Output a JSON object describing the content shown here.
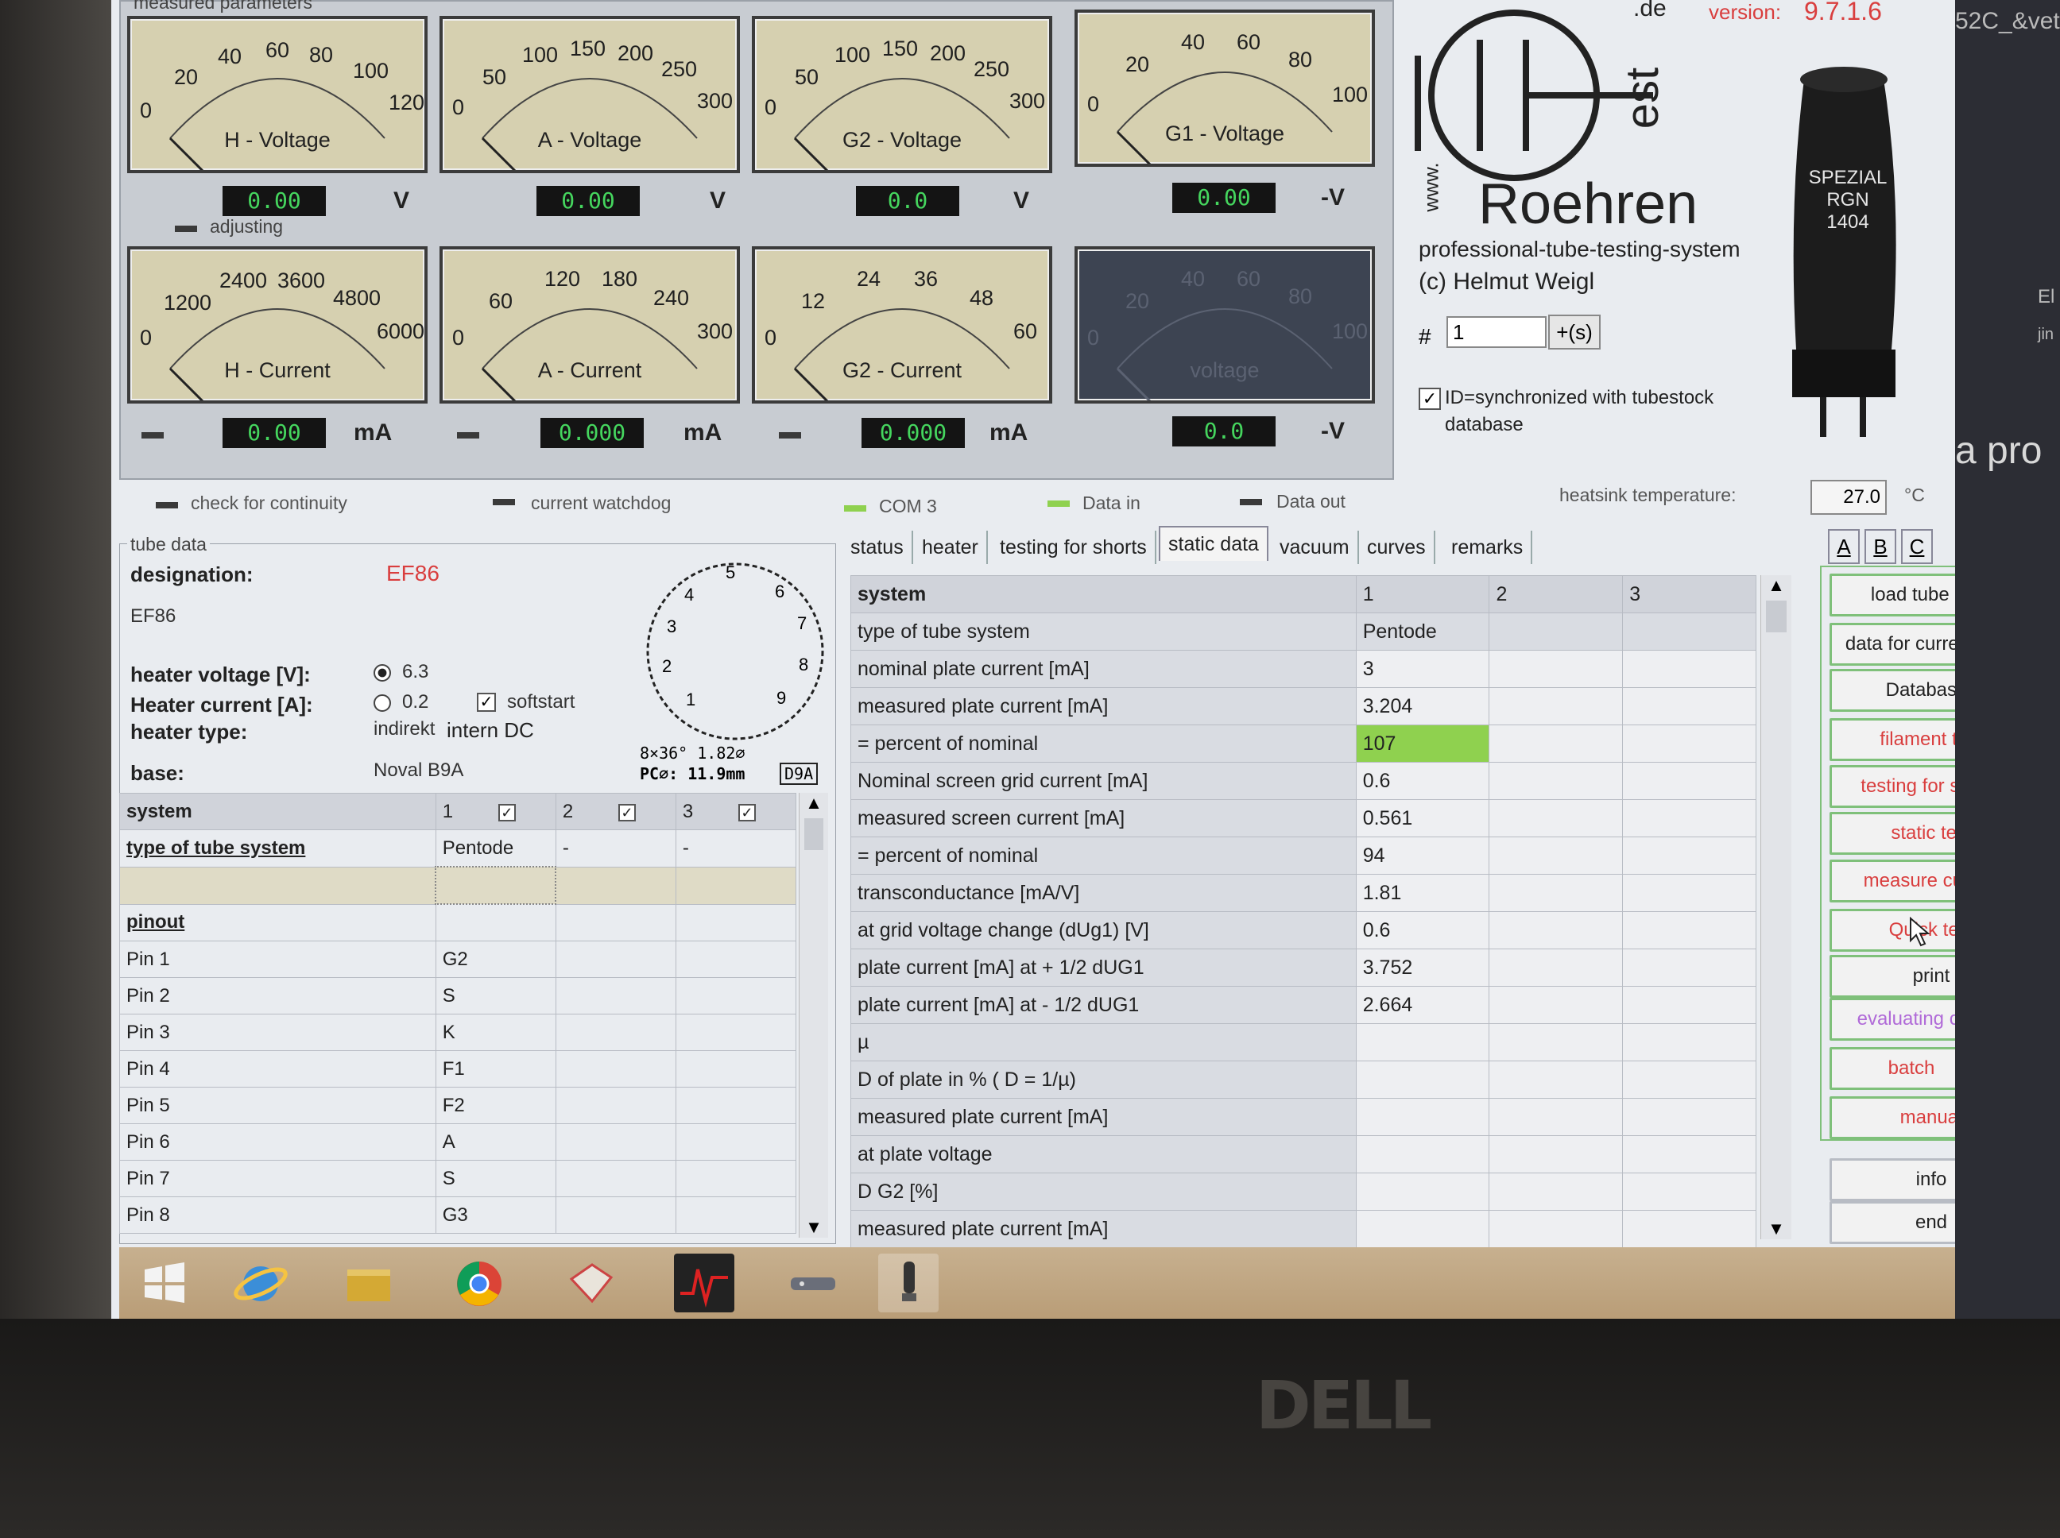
{
  "meters_title": "measured parameters",
  "meters": [
    {
      "name": "H - Voltage",
      "scale": [
        "0",
        "20",
        "40",
        "60",
        "80",
        "100",
        "120"
      ],
      "display": "0.00",
      "unit": "V"
    },
    {
      "name": "A - Voltage",
      "scale": [
        "0",
        "50",
        "100",
        "150",
        "200",
        "250",
        "300"
      ],
      "display": "0.00",
      "unit": "V"
    },
    {
      "name": "G2 - Voltage",
      "scale": [
        "0",
        "50",
        "100",
        "150",
        "200",
        "250",
        "300"
      ],
      "display": "0.0",
      "unit": "V"
    },
    {
      "name": "G1 - Voltage",
      "scale": [
        "0",
        "20",
        "40",
        "60",
        "80",
        "100"
      ],
      "display": "0.00",
      "unit": "-V"
    },
    {
      "name": "H - Current",
      "scale": [
        "0",
        "1200",
        "2400",
        "3600",
        "4800",
        "6000"
      ],
      "display": "0.00",
      "unit": "mA"
    },
    {
      "name": "A - Current",
      "scale": [
        "0",
        "60",
        "120",
        "180",
        "240",
        "300"
      ],
      "display": "0.000",
      "unit": "mA"
    },
    {
      "name": "G2 - Current",
      "scale": [
        "0",
        "12",
        "24",
        "36",
        "48",
        "60"
      ],
      "display": "0.000",
      "unit": "mA"
    },
    {
      "name": "voltage",
      "scale": [
        "0",
        "20",
        "40",
        "60",
        "80",
        "100"
      ],
      "display": "0.0",
      "unit": "-V"
    }
  ],
  "adjusting_label": "adjusting",
  "brand": {
    "version_label": "version:",
    "version": "9.7.1.6",
    "domain": ".de",
    "www": "www.",
    "logo_text": "Roehren",
    "logo_suffix": "est",
    "tagline": "professional-tube-testing-system",
    "copyright": "(c) Helmut Weigl",
    "tube_print": "SPEZIAL RGN 1404"
  },
  "counter": {
    "hash": "#",
    "value": "1",
    "plus_button": "+(s)"
  },
  "sync_label": "ID=synchronized with tubestock database",
  "status_bar": {
    "continuity": "check for continuity",
    "watchdog": "current watchdog",
    "com": "COM 3",
    "data_in": "Data in",
    "data_out": "Data out",
    "heatsink_label": "heatsink temperature:",
    "heatsink_value": "27.0",
    "heatsink_unit": "°C"
  },
  "tube_data": {
    "legend": "tube data",
    "designation_label": "designation:",
    "designation": "EF86",
    "designation_sub": "EF86",
    "heater_voltage_label": "heater voltage [V]:",
    "heater_voltage": "6.3",
    "heater_current_label": "Heater current [A]:",
    "heater_current": "0.2",
    "softstart": "softstart",
    "heater_type_label": "heater type:",
    "heater_type": "indirekt",
    "heater_supply": "intern DC",
    "base_label": "base:",
    "base": "Noval B9A",
    "socket_dims": "8×36° 1.82⌀",
    "socket_pc": "PC⌀: 11.9mm",
    "socket_code": "D9A",
    "pin_numbers": [
      "1",
      "2",
      "3",
      "4",
      "5",
      "6",
      "7",
      "8",
      "9"
    ]
  },
  "left_table": {
    "header": [
      "system",
      "1",
      "2",
      "3"
    ],
    "type_label": "type of tube system",
    "type_values": [
      "Pentode",
      "-",
      "-"
    ],
    "pinout_label": "pinout",
    "pins": [
      {
        "pin": "Pin 1",
        "value": "G2"
      },
      {
        "pin": "Pin 2",
        "value": "S"
      },
      {
        "pin": "Pin 3",
        "value": "K"
      },
      {
        "pin": "Pin 4",
        "value": "F1"
      },
      {
        "pin": "Pin 5",
        "value": "F2"
      },
      {
        "pin": "Pin 6",
        "value": "A"
      },
      {
        "pin": "Pin 7",
        "value": "S"
      },
      {
        "pin": "Pin 8",
        "value": "G3"
      }
    ]
  },
  "tabs": [
    "status",
    "heater",
    "testing for shorts",
    "static data",
    "vacuum",
    "curves",
    "remarks"
  ],
  "abc_tabs": [
    "A",
    "B",
    "C"
  ],
  "static_table": {
    "header": [
      "system",
      "1",
      "2",
      "3"
    ],
    "rows": [
      {
        "label": "type of tube system",
        "v1": "Pentode"
      },
      {
        "label": "nominal plate current [mA]",
        "v1": "3"
      },
      {
        "label": "measured plate current [mA]",
        "v1": "3.204"
      },
      {
        "label": "= percent of nominal",
        "v1": "107"
      },
      {
        "label": "Nominal screen grid current [mA]",
        "v1": "0.6"
      },
      {
        "label": "measured screen current [mA]",
        "v1": "0.561"
      },
      {
        "label": "= percent of nominal",
        "v1": "94"
      },
      {
        "label": "transconductance [mA/V]",
        "v1": "1.81"
      },
      {
        "label": "at grid voltage change (dUg1) [V]",
        "v1": "0.6"
      },
      {
        "label": "plate current [mA] at + 1/2 dUG1",
        "v1": "3.752"
      },
      {
        "label": "plate current [mA] at - 1/2 dUG1",
        "v1": "2.664"
      },
      {
        "label": "µ",
        "v1": ""
      },
      {
        "label": "D of plate in % ( D = 1/µ)",
        "v1": ""
      },
      {
        "label": "measured plate current [mA]",
        "v1": ""
      },
      {
        "label": "at plate voltage",
        "v1": ""
      },
      {
        "label": "D G2 [%]",
        "v1": ""
      },
      {
        "label": "measured plate current [mA]",
        "v1": ""
      }
    ]
  },
  "buttons": {
    "load": "load tube data",
    "current": "data for current tube",
    "databases": "Databases",
    "filament": "filament test",
    "shorts": "testing for shorts",
    "static": "static test",
    "curves": "measure curves",
    "quick": "Quick test",
    "print": "print",
    "evaluating": "evaluating curves",
    "batch": "batch",
    "manual": "manual",
    "info": "info",
    "end": "end"
  },
  "background_window": {
    "title_fragment": "52C_&vet",
    "text_fragment": "a pro",
    "side_text": "El",
    "side_text2": "jin"
  },
  "colors": {
    "accent_green": "#8fd14f",
    "red_text": "#d93e3e",
    "purple_text": "#b06ad8",
    "lcd_green": "#45d65e"
  }
}
